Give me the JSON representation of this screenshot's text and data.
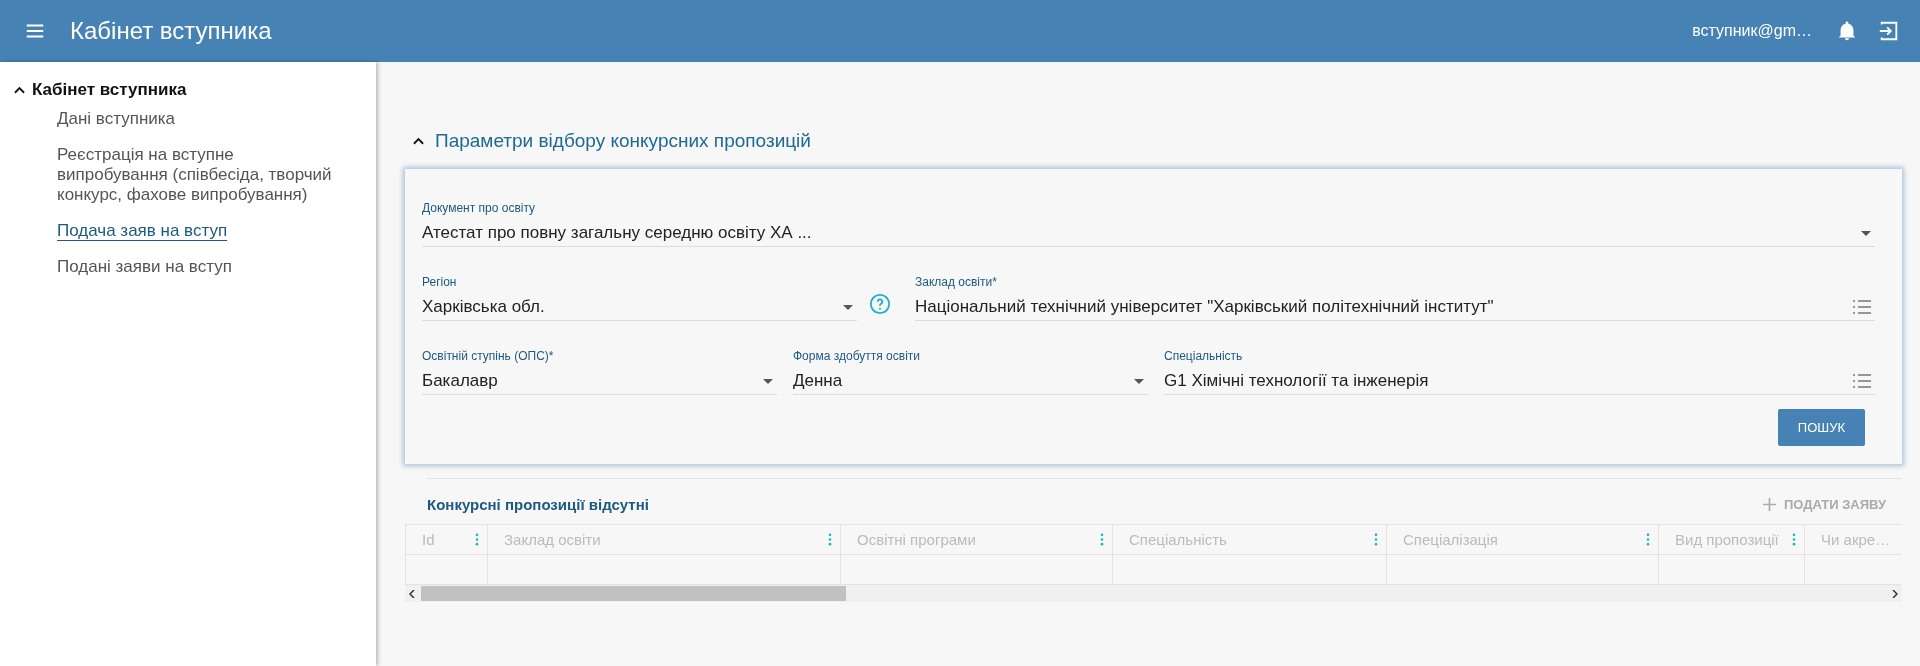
{
  "header": {
    "title": "Кабінет вступника",
    "user": "вступник@gm…"
  },
  "sidebar": {
    "group": {
      "label": "Кабінет вступника",
      "expanded": true,
      "items": [
        {
          "label": "Дані вступника",
          "selected": false
        },
        {
          "label": "Реєстрація на вступне випробування (співбесіда, творчий конкурс, фахове випробування)",
          "selected": false
        },
        {
          "label": "Подача заяв на вступ",
          "selected": true
        },
        {
          "label": "Подані заяви на вступ",
          "selected": false
        }
      ]
    }
  },
  "filters": {
    "title": "Параметри відбору конкурсних пропозицій",
    "expanded": true,
    "document": {
      "label": "Документ про освіту",
      "value": "Атестат про повну загальну середню освіту ХА ..."
    },
    "region": {
      "label": "Регіон",
      "value": "Харківська обл."
    },
    "institution": {
      "label": "Заклад освіти*",
      "value": "Національний технічний університет \"Харківський політехнічний інститут\""
    },
    "degree": {
      "label": "Освітній ступінь (ОПС)*",
      "value": "Бакалавр"
    },
    "study_form": {
      "label": "Форма здобуття освіти",
      "value": "Денна"
    },
    "specialty": {
      "label": "Спеціальність",
      "value": "G1 Хімічні технології та інженерія"
    },
    "search_button": "ПОШУК"
  },
  "results": {
    "title": "Конкурсні пропозиції відсутні",
    "apply_button": {
      "label": "ПОДАТИ ЗАЯВУ",
      "disabled": true
    },
    "columns": [
      {
        "label": "Id",
        "menu": true
      },
      {
        "label": "Заклад освіти",
        "menu": true
      },
      {
        "label": "Освітні програми",
        "menu": true
      },
      {
        "label": "Спеціальність",
        "menu": true
      },
      {
        "label": "Спеціалізація",
        "menu": true
      },
      {
        "label": "Вид пропозиції",
        "menu": true
      },
      {
        "label": "Чи акре…",
        "menu": false
      }
    ]
  }
}
